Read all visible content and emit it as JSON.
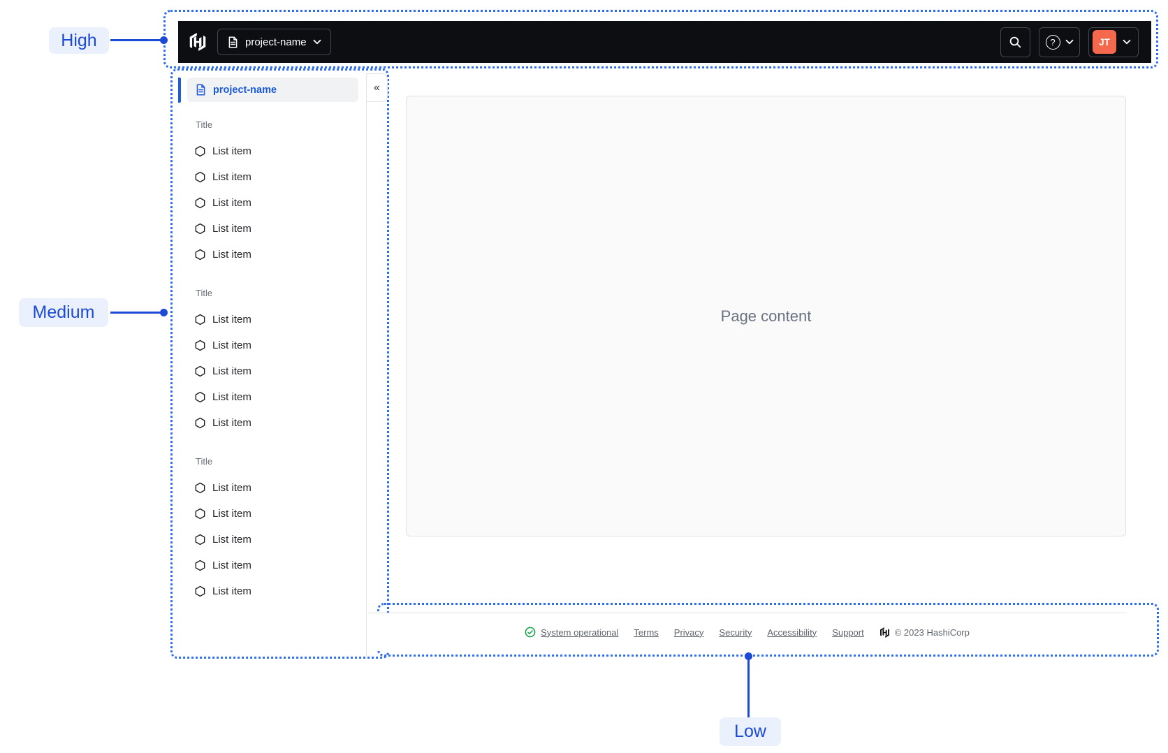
{
  "annotations": {
    "high": {
      "label": "High"
    },
    "medium": {
      "label": "Medium"
    },
    "low": {
      "label": "Low"
    }
  },
  "top_nav": {
    "project_selector": {
      "label": "project-name"
    },
    "help_glyph": "?",
    "user_menu": {
      "avatar_initials": "JT"
    }
  },
  "side_nav": {
    "active_item": {
      "label": "project-name"
    },
    "collapse_glyph": "«",
    "sections": [
      {
        "title": "Title",
        "items": [
          "List item",
          "List item",
          "List item",
          "List item",
          "List item"
        ]
      },
      {
        "title": "Title",
        "items": [
          "List item",
          "List item",
          "List item",
          "List item",
          "List item"
        ]
      },
      {
        "title": "Title",
        "items": [
          "List item",
          "List item",
          "List item",
          "List item",
          "List item"
        ]
      }
    ]
  },
  "main": {
    "placeholder": "Page content"
  },
  "footer": {
    "status_label": "System operational",
    "links": [
      "Terms",
      "Privacy",
      "Security",
      "Accessibility",
      "Support"
    ],
    "copyright": "© 2023 HashiCorp"
  },
  "colors": {
    "annotation_blue": "#1C49D6",
    "annotation_dotted_border": "#2D6BF2",
    "annotation_pill_bg": "#EAF1FD",
    "nav_background": "#0D0E12",
    "accent_blue": "#1C5BDC",
    "avatar_orange": "#F4694E",
    "status_green": "#0FA04A",
    "placeholder_gray": "#6A7280"
  }
}
